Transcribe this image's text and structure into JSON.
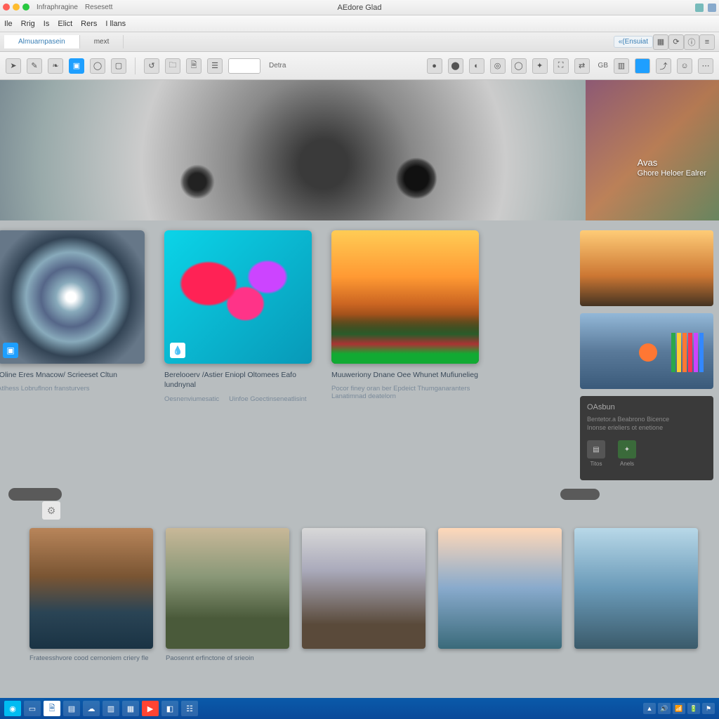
{
  "titlebar": {
    "title": "AEdore Glad",
    "left_label_1": "Infraphragine",
    "left_label_2": "Resesett"
  },
  "menu": {
    "items": [
      "Ile",
      "Rrig",
      "Is",
      "Elict",
      "Rers",
      "I llans"
    ]
  },
  "tabs": {
    "t1": "Almuarnpasein",
    "t2": "mext",
    "btn1": "«(Ensuiat",
    "btn2": "⟳"
  },
  "toolbar": {
    "label1": "Detra",
    "label2": "GB"
  },
  "hero": {
    "line1": "Avas",
    "line2": "Ghore Heloer Ealrer"
  },
  "cards": [
    {
      "title": "tOline Eres Mnacow/ Scrieeset Cltun",
      "sub": "Atlhess Lobruflnon fransturvers"
    },
    {
      "title": "Berelooerv /Astier Eniopl Oltomees Eafo lundnynal",
      "link1": "Oesnenviumesatic",
      "link2": "Uinfoe Goectinseneatlisint"
    },
    {
      "title": "Muuweriony Dnane Oee Whunet Mufiunelieg",
      "sub": "Pocor finey oran ber Epdeict Thumganaranters Lanatimnad deatelorn"
    }
  ],
  "rightpanel": {
    "heading": "OAsbun",
    "desc": "Bentetor.a Beabrono Bicence",
    "sub": "Inonse erieliers ot enetione",
    "tag": "Titos",
    "icon2": "Anels"
  },
  "row2": [
    {
      "title": "Frateesshvore cood cernoniem criery fle"
    },
    {
      "title": "Paosennt erfinctone of srieoin"
    },
    {
      "title": ""
    },
    {
      "title": ""
    },
    {
      "title": ""
    }
  ],
  "colors": {
    "bars": [
      "#2aa84a",
      "#ffcc33",
      "#ff7733",
      "#ff3355",
      "#cc44ff",
      "#3388ff"
    ]
  }
}
